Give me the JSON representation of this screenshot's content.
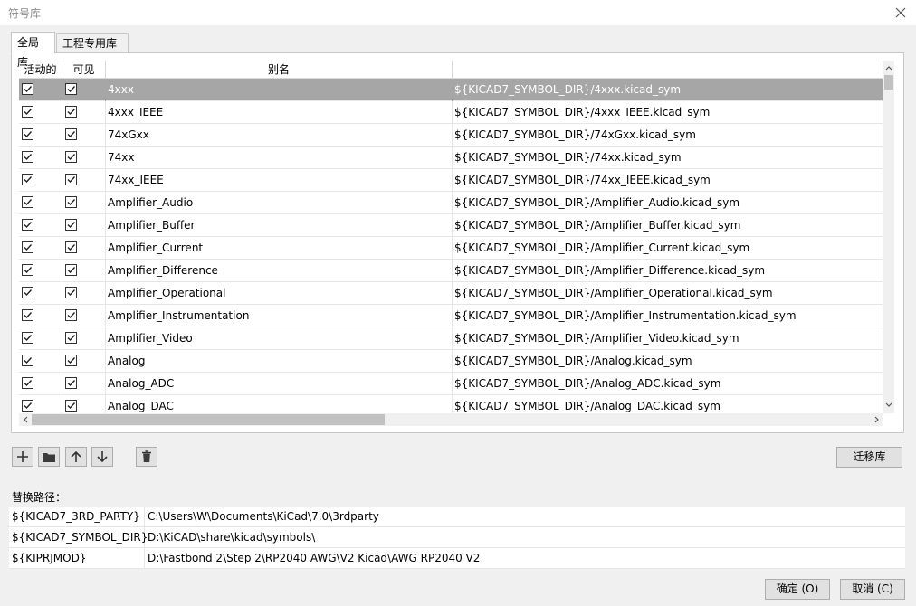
{
  "window": {
    "title": "符号库"
  },
  "tabs": [
    {
      "label": "全局库"
    },
    {
      "label": "工程专用库"
    }
  ],
  "grid": {
    "headers": {
      "active": "活动的",
      "visible": "可见",
      "nickname": "别名",
      "path": ""
    },
    "rows": [
      {
        "nickname": "4xxx",
        "path": "${KICAD7_SYMBOL_DIR}/4xxx.kicad_sym",
        "active": true,
        "visible": true,
        "selected": true
      },
      {
        "nickname": "4xxx_IEEE",
        "path": "${KICAD7_SYMBOL_DIR}/4xxx_IEEE.kicad_sym",
        "active": true,
        "visible": true
      },
      {
        "nickname": "74xGxx",
        "path": "${KICAD7_SYMBOL_DIR}/74xGxx.kicad_sym",
        "active": true,
        "visible": true
      },
      {
        "nickname": "74xx",
        "path": "${KICAD7_SYMBOL_DIR}/74xx.kicad_sym",
        "active": true,
        "visible": true
      },
      {
        "nickname": "74xx_IEEE",
        "path": "${KICAD7_SYMBOL_DIR}/74xx_IEEE.kicad_sym",
        "active": true,
        "visible": true
      },
      {
        "nickname": "Amplifier_Audio",
        "path": "${KICAD7_SYMBOL_DIR}/Amplifier_Audio.kicad_sym",
        "active": true,
        "visible": true
      },
      {
        "nickname": "Amplifier_Buffer",
        "path": "${KICAD7_SYMBOL_DIR}/Amplifier_Buffer.kicad_sym",
        "active": true,
        "visible": true
      },
      {
        "nickname": "Amplifier_Current",
        "path": "${KICAD7_SYMBOL_DIR}/Amplifier_Current.kicad_sym",
        "active": true,
        "visible": true
      },
      {
        "nickname": "Amplifier_Difference",
        "path": "${KICAD7_SYMBOL_DIR}/Amplifier_Difference.kicad_sym",
        "active": true,
        "visible": true
      },
      {
        "nickname": "Amplifier_Operational",
        "path": "${KICAD7_SYMBOL_DIR}/Amplifier_Operational.kicad_sym",
        "active": true,
        "visible": true
      },
      {
        "nickname": "Amplifier_Instrumentation",
        "path": "${KICAD7_SYMBOL_DIR}/Amplifier_Instrumentation.kicad_sym",
        "active": true,
        "visible": true
      },
      {
        "nickname": "Amplifier_Video",
        "path": "${KICAD7_SYMBOL_DIR}/Amplifier_Video.kicad_sym",
        "active": true,
        "visible": true
      },
      {
        "nickname": "Analog",
        "path": "${KICAD7_SYMBOL_DIR}/Analog.kicad_sym",
        "active": true,
        "visible": true
      },
      {
        "nickname": "Analog_ADC",
        "path": "${KICAD7_SYMBOL_DIR}/Analog_ADC.kicad_sym",
        "active": true,
        "visible": true
      },
      {
        "nickname": "Analog_DAC",
        "path": "${KICAD7_SYMBOL_DIR}/Analog_DAC.kicad_sym",
        "active": true,
        "visible": true
      }
    ]
  },
  "toolbar": {
    "icons": [
      "plus-icon",
      "folder-icon",
      "arrow-up-icon",
      "arrow-down-icon",
      "trash-icon"
    ],
    "migrate_label": "迁移库"
  },
  "substitutions": {
    "label": "替换路径：",
    "rows": [
      {
        "name": "${KICAD7_3RD_PARTY}",
        "value": "C:\\Users\\W\\Documents\\KiCad\\7.0\\3rdparty"
      },
      {
        "name": "${KICAD7_SYMBOL_DIR}",
        "value": "D:\\KiCAD\\share\\kicad\\symbols\\"
      },
      {
        "name": "${KIPRJMOD}",
        "value": "D:\\Fastbond 2\\Step 2\\RP2040 AWG\\V2 Kicad\\AWG RP2040 V2"
      }
    ]
  },
  "buttons": {
    "ok": "确定 (O)",
    "cancel": "取消 (C)"
  },
  "colors": {
    "selected_row": "#a6a6a6",
    "background": "#f0f0f0"
  }
}
